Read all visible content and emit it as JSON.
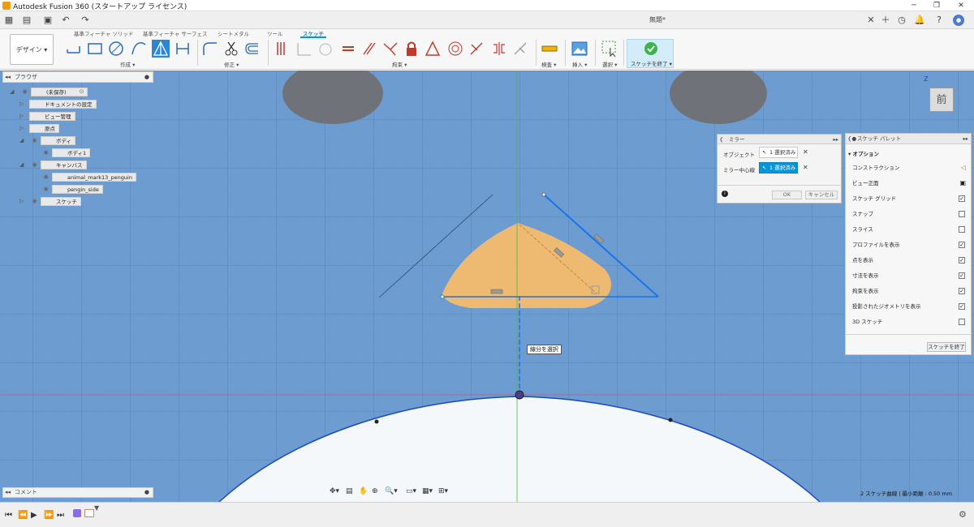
{
  "window": {
    "title": "Autodesk Fusion 360 (スタートアップ ライセンス)",
    "document_tab": "無題*",
    "minimize": "─",
    "maximize": "❐",
    "close": "✕"
  },
  "ribbon": {
    "workspace": "デザイン ▾",
    "tabs": [
      "基準フィーチャ ソリッド",
      "基準フィーチャ サーフェス",
      "シートメタル",
      "ツール",
      "スケッチ"
    ],
    "active_tab": "スケッチ",
    "groups": {
      "create": "作成 ▾",
      "modify": "修正 ▾",
      "constraints": "拘束 ▾",
      "inspect": "検査 ▾",
      "insert": "挿入 ▾",
      "select": "選択 ▾",
      "finish": "スケッチを終了 ▾"
    }
  },
  "browser": {
    "title": "ブラウザ",
    "items": [
      {
        "label": "(未保存)",
        "level": 0
      },
      {
        "label": "ドキュメントの設定",
        "level": 1
      },
      {
        "label": "ビュー管理",
        "level": 1
      },
      {
        "label": "原点",
        "level": 1
      },
      {
        "label": "ボディ",
        "level": 1
      },
      {
        "label": "ボディ1",
        "level": 2
      },
      {
        "label": "キャンバス",
        "level": 1
      },
      {
        "label": "animal_mark13_penguin",
        "level": 2
      },
      {
        "label": "pengin_side",
        "level": 2
      },
      {
        "label": "スケッチ",
        "level": 1
      }
    ]
  },
  "mirror_dialog": {
    "title": "ミラー",
    "object_label": "オブジェクト",
    "object_value": "1 選択済み",
    "axis_label": "ミラー中心線",
    "axis_value": "1 選択済み",
    "ok": "OK",
    "cancel": "キャンセル",
    "info": "i"
  },
  "sketch_palette": {
    "title": "スケッチ パレット",
    "section": "オプション",
    "rows": [
      {
        "label": "コンストラクション",
        "kind": "icon"
      },
      {
        "label": "ビュー正面",
        "kind": "icon"
      },
      {
        "label": "スケッチ グリッド",
        "checked": true
      },
      {
        "label": "スナップ",
        "checked": false
      },
      {
        "label": "スライス",
        "checked": false
      },
      {
        "label": "プロファイルを表示",
        "checked": true
      },
      {
        "label": "点を表示",
        "checked": true
      },
      {
        "label": "寸法を表示",
        "checked": true
      },
      {
        "label": "拘束を表示",
        "checked": true
      },
      {
        "label": "投影されたジオメトリを表示",
        "checked": true
      },
      {
        "label": "3D スケッチ",
        "checked": false
      }
    ],
    "finish_button": "スケッチを終了"
  },
  "viewport": {
    "tooltip": "線分を選択",
    "status": "2 スケッチ曲線 | 最小距離 : 0.50 mm",
    "viewcube_label": "前",
    "viewcube_axis": "Z"
  },
  "comments": {
    "label": "コメント"
  },
  "colors": {
    "accent": "#0696d7",
    "canvas_blue": "#6d9cd1",
    "penguin_orange": "#f7bd6a",
    "sketch_line": "#1a73e8"
  }
}
